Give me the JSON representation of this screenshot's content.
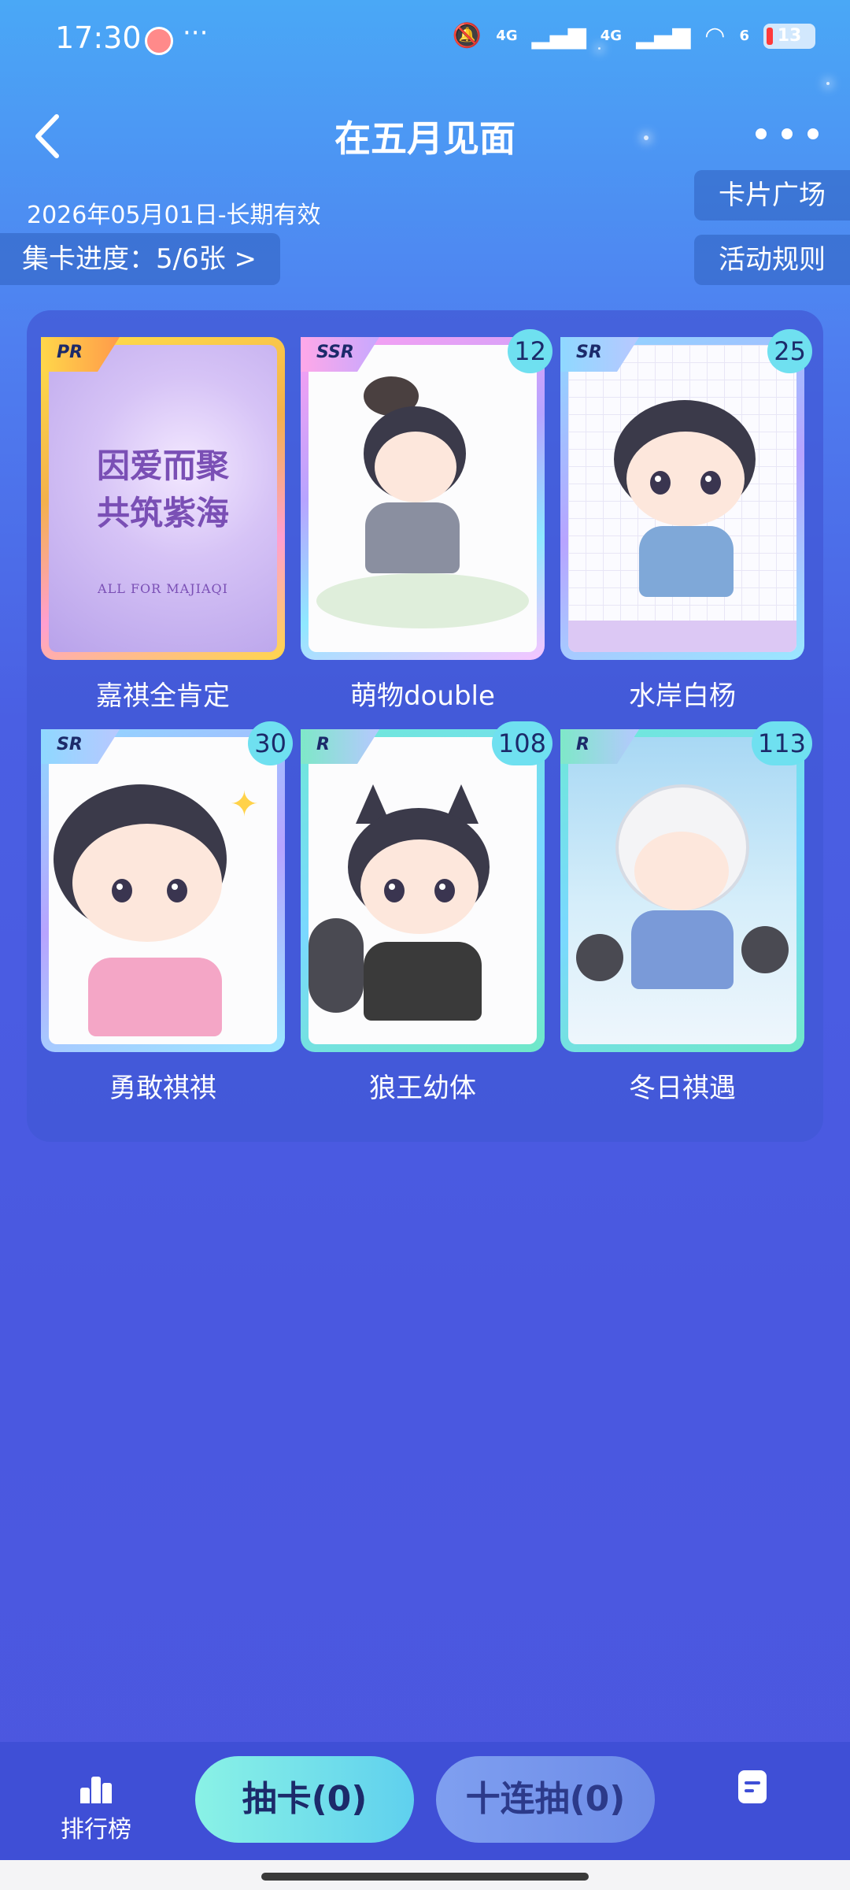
{
  "status_bar": {
    "time": "17:30",
    "dots": "···",
    "network_1": "4G",
    "network_2": "4G",
    "wifi_label": "6",
    "battery": "13"
  },
  "header": {
    "title": "在五月见面",
    "validity": "2026年05月01日-长期有效",
    "progress": "集卡进度：5/6张 >",
    "card_square": "卡片广场",
    "rules": "活动规则"
  },
  "cards": [
    {
      "rarity": "PR",
      "count": "",
      "name": "嘉祺全肯定",
      "art_title_1": "因爱而聚",
      "art_title_2": "共筑紫海",
      "art_sub": "ALL FOR MAJIAQI"
    },
    {
      "rarity": "SSR",
      "count": "12",
      "name": "萌物double"
    },
    {
      "rarity": "SR",
      "count": "25",
      "name": "水岸白杨"
    },
    {
      "rarity": "SR",
      "count": "30",
      "name": "勇敢祺祺"
    },
    {
      "rarity": "R",
      "count": "108",
      "name": "狼王幼体"
    },
    {
      "rarity": "R",
      "count": "113",
      "name": "冬日祺遇"
    }
  ],
  "bottom": {
    "rank_label": "排行榜",
    "draw_label": "抽卡(0)",
    "draw10_label": "十连抽(0)"
  },
  "icons": {
    "back": "chevron-left-icon",
    "more": "more-dots-icon",
    "rank": "bar-chart-icon",
    "record": "document-icon"
  },
  "colors": {
    "accent": "#6fe0f0",
    "background_top": "#4aa8f6",
    "background_bottom": "#4c57df"
  }
}
